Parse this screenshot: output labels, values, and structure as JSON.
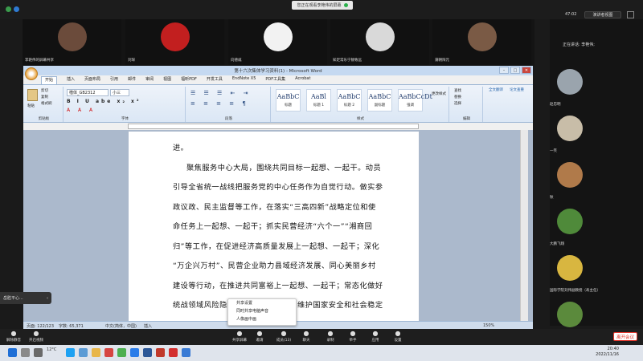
{
  "meeting": {
    "share_notice": "您正在观看李艳伟的屏幕",
    "timer": "47:02",
    "view_button": "演讲者视图",
    "speaking_label": "正在讲话: 李艳伟;",
    "gallery": [
      {
        "name": "李艳伟的屏幕共享",
        "color": "#6b4b3b"
      },
      {
        "name": "刘琛",
        "color": "#c21f1f"
      },
      {
        "name": "向德威",
        "color": "#f2f2f2"
      },
      {
        "name": "知足常乐宁静致远",
        "color": "#d9d9d9"
      },
      {
        "name": "蒲朝阳元",
        "color": "#7a5a45"
      }
    ],
    "right_panel": [
      {
        "name": "赵忠明",
        "color": "#9aa4ad"
      },
      {
        "name": "一笑",
        "color": "#c8bda8"
      },
      {
        "name": "秋",
        "color": "#b07a4a"
      },
      {
        "name": "大鹏飞翔",
        "color": "#4f8a3a"
      },
      {
        "name": "国际学院刘伟副教授（寿主任）",
        "color": "#d8b640"
      },
      {
        "name": "",
        "color": "#5b8a3c"
      }
    ],
    "side_pill": "岳胜平心...",
    "popup_items": [
      "共享设置",
      "同时共享电脑声音",
      "人像画中画"
    ],
    "toolbar": [
      {
        "name": "解除静音",
        "icon": "mic-icon"
      },
      {
        "name": "开启视频",
        "icon": "video-icon"
      },
      {
        "name": "共享屏幕",
        "icon": "share-icon"
      },
      {
        "name": "邀请",
        "icon": "invite-icon"
      },
      {
        "name": "成员(13)",
        "icon": "members-icon"
      },
      {
        "name": "聊天",
        "icon": "chat-icon"
      },
      {
        "name": "录制",
        "icon": "record-icon"
      },
      {
        "name": "举手",
        "icon": "hand-icon"
      },
      {
        "name": "应用",
        "icon": "apps-icon"
      },
      {
        "name": "设置",
        "icon": "settings-icon"
      }
    ],
    "end_button": "离开会议"
  },
  "word": {
    "title": "第十六次集体学习资料(1) - Microsoft Word",
    "tabs": [
      "开始",
      "插入",
      "页面布局",
      "引用",
      "邮件",
      "审阅",
      "视图",
      "福昕PDF",
      "开发工具",
      "EndNote X5",
      "PDF工具集",
      "Acrobat"
    ],
    "font_name": "楷体_GB2312",
    "font_size": "小三",
    "paste_label": "粘贴",
    "cut_label": "剪切",
    "copy_label": "复制",
    "format_label": "格式刷",
    "group_labels": [
      "剪贴板",
      "字体",
      "段落",
      "样式",
      "编辑"
    ],
    "styles": [
      {
        "preview": "AaBbC",
        "name": "标题"
      },
      {
        "preview": "AaBl",
        "name": "标题 1"
      },
      {
        "preview": "AaBbC",
        "name": "标题 2"
      },
      {
        "preview": "AaBbC",
        "name": "副标题"
      },
      {
        "preview": "AaBbCcDt",
        "name": "强调"
      }
    ],
    "change_styles": "更改样式",
    "find": "查找",
    "replace": "替换",
    "select": "选择",
    "full_translate": "全文翻译",
    "doc_compare": "论文查重",
    "lines": [
      "进。",
      "聚焦服务中心大局，围绕共同目标一起想、一起干。动员",
      "引导全省统一战线把服务党的中心任务作为自觉行动。做实参",
      "政议政、民主监督等工作，在落实“三高四新”战略定位和使",
      "命任务上一起想、一起干；抓实民营经济“六个一”“湘商回",
      "归”等工作，在促进经济高质量发展上一起想、一起干；深化",
      "“万企兴万村”、民营企业助力县域经济发展、同心美丽乡村",
      "建设等行动，在推进共同富裕上一起想、一起干；常态化做好",
      "统战领域风险隐患防范化解工作，在维护国家安全和社会稳定",
      "上一起想、一起干"
    ],
    "status": {
      "page": "页面: 122/123",
      "words": "字数: 65,371",
      "lang": "中文(简体，中国)",
      "mode": "插入",
      "zoom": "150%"
    }
  },
  "taskbar": {
    "time": "20:40",
    "date": "2022/11/16",
    "temp": "12°C"
  }
}
